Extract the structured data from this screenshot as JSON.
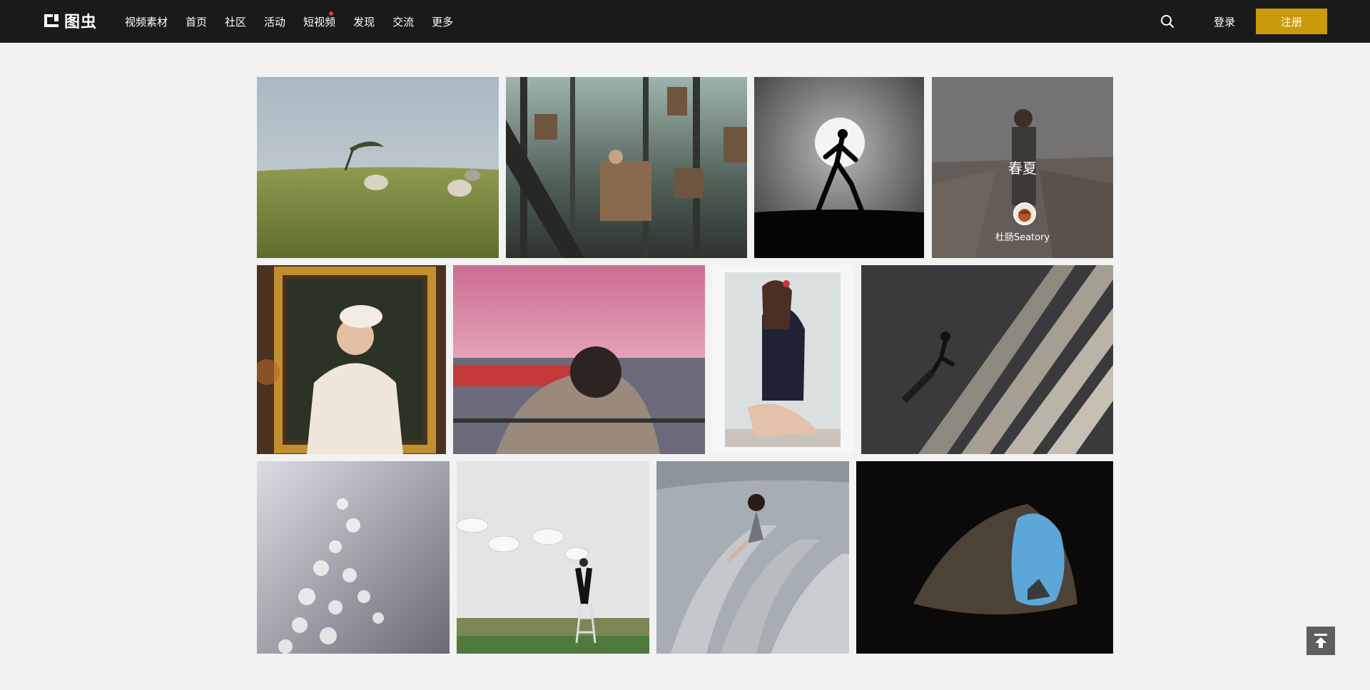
{
  "brand": {
    "logo_text": "图虫"
  },
  "nav": {
    "items": [
      "视频素材",
      "首页",
      "社区",
      "活动",
      "短视频",
      "发现",
      "交流",
      "更多"
    ]
  },
  "header": {
    "search_icon": "search-icon",
    "login_label": "登录",
    "register_label": "注册",
    "accent_color": "#c99a0a"
  },
  "gallery": {
    "hover_card": {
      "title": "春夏",
      "author": "杜肠Seatory"
    }
  },
  "icons": {
    "back_to_top": "arrow-up-to-line-icon"
  }
}
